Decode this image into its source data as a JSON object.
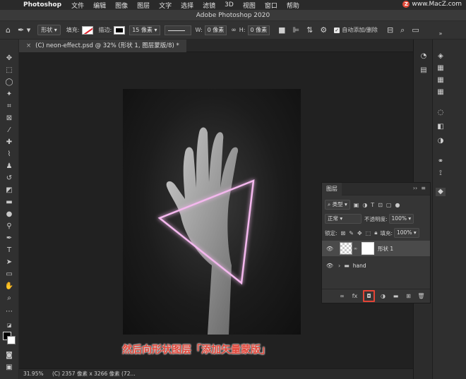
{
  "menubar": {
    "app": "Photoshop",
    "items": [
      "文件",
      "编辑",
      "图像",
      "图层",
      "文字",
      "选择",
      "滤镜",
      "3D",
      "视图",
      "窗口",
      "帮助"
    ],
    "brand": "www.MacZ.com"
  },
  "window": {
    "title": "Adobe Photoshop 2020"
  },
  "options": {
    "mode": "形状",
    "fill_label": "填充:",
    "stroke_label": "描边:",
    "stroke_width": "15 像素",
    "w_label": "W:",
    "w_value": "0 像素",
    "h_label": "H:",
    "h_value": "0 像素",
    "auto_add_delete": "自动添加/删除"
  },
  "document": {
    "tab_title": "(C) neon-effect.psd @ 32% (形状 1, 图层蒙版/8) *",
    "stroke_color": "#f4b8ee"
  },
  "status": {
    "zoom": "31.95%",
    "info": "(C) 2357 像素 x 3266 像素 (72..."
  },
  "layers_panel": {
    "title": "图层",
    "filter": "类型",
    "blend_mode": "正常",
    "opacity_label": "不透明度:",
    "opacity": "100%",
    "lock_label": "锁定:",
    "fill_label": "填充:",
    "fill": "100%",
    "layers": [
      {
        "name": "形状 1",
        "selected": true
      },
      {
        "name": "hand",
        "selected": false
      }
    ]
  },
  "caption": "然后向形状图层「添加矢量蒙版」"
}
